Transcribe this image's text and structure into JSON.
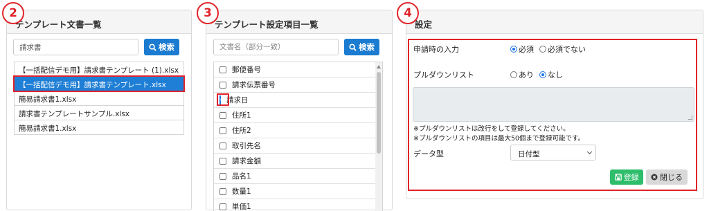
{
  "steps": [
    "2",
    "3",
    "4"
  ],
  "panel_templates": {
    "title": "テンプレート文書一覧",
    "search_value": "請求書",
    "search_button": "検索",
    "files": [
      "【一括配信デモ用】請求書テンプレート (1).xlsx",
      "【一括配信デモ用】請求書テンプレート.xlsx",
      "簡易請求書1.xlsx",
      "請求書テンプレートサンプル.xlsx",
      "簡易請求書1.xlsx"
    ],
    "selected_index": 1
  },
  "panel_fields": {
    "title": "テンプレート設定項目一覧",
    "search_placeholder": "文書名（部分一致）",
    "search_button": "検索",
    "fields": [
      {
        "label": "郵便番号",
        "checked": false
      },
      {
        "label": "請求伝票番号",
        "checked": false
      },
      {
        "label": "請求日",
        "checked": true
      },
      {
        "label": "住所1",
        "checked": false
      },
      {
        "label": "住所2",
        "checked": false
      },
      {
        "label": "取引先名",
        "checked": false
      },
      {
        "label": "請求金額",
        "checked": false
      },
      {
        "label": "品名1",
        "checked": false
      },
      {
        "label": "数量1",
        "checked": false
      },
      {
        "label": "単価1",
        "checked": false
      }
    ]
  },
  "panel_settings": {
    "title": "設定",
    "input_label": "申請時の入力",
    "input_options": [
      "必須",
      "必須でない"
    ],
    "input_selected": "必須",
    "dropdown_label": "プルダウンリスト",
    "dropdown_options": [
      "あり",
      "なし"
    ],
    "dropdown_selected": "なし",
    "note1": "※プルダウンリストは改行をして登録してください。",
    "note2": "※プルダウンリストの項目は最大50個まで登録可能です。",
    "datatype_label": "データ型",
    "datatype_value": "日付型",
    "register_button": "登録",
    "close_button": "閉じる"
  },
  "colors": {
    "accent_red": "#e0242a",
    "primary_blue": "#1a7bd0",
    "selected_row": "#1f7fd6",
    "success_green": "#2ebd6b"
  }
}
